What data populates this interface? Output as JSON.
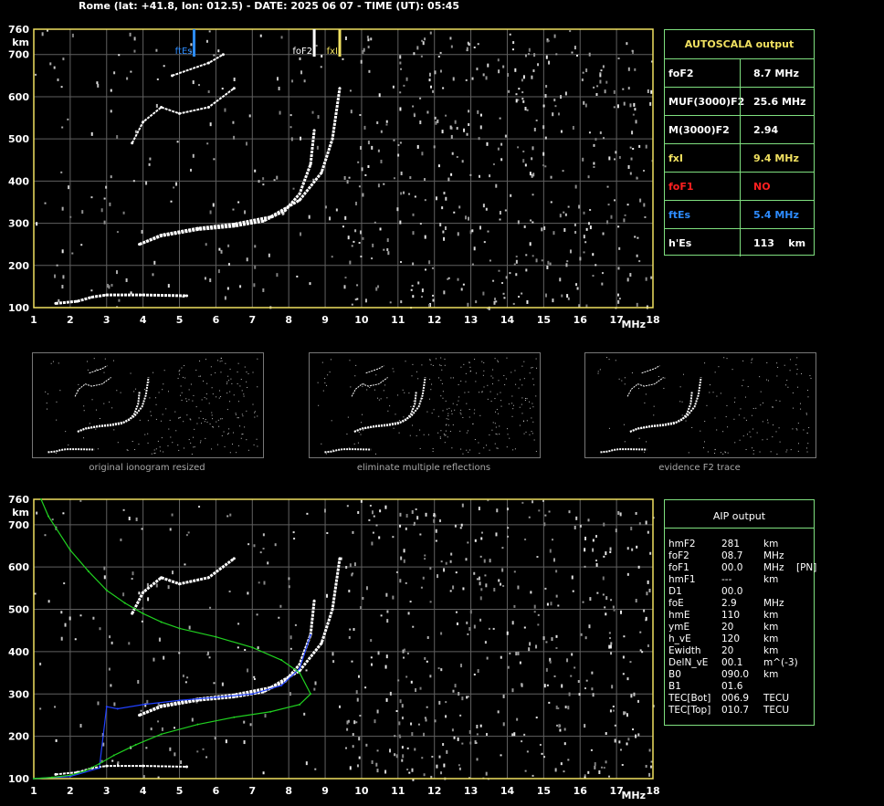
{
  "header": "Rome (lat: +41.8, lon: 012.5) - DATE: 2025 06 07 - TIME (UT): 05:45",
  "colors": {
    "axis": "#f0e060",
    "grid": "#606060",
    "trace": "#ffffff",
    "green": "#20d020",
    "blue": "#2040ff",
    "panel_border": "#7fe07f",
    "ftEs": "#2d8cff",
    "fxI": "#f0e060",
    "foF1": "#ff2020"
  },
  "chart_data": [
    {
      "type": "scatter",
      "title": "",
      "xlabel": "MHz",
      "ylabel": "km",
      "xlim": [
        1,
        18
      ],
      "ylim": [
        100,
        760
      ],
      "x_ticks": [
        "1",
        "2",
        "3",
        "4",
        "5",
        "6",
        "7",
        "8",
        "9",
        "10",
        "11",
        "12",
        "13",
        "14",
        "15",
        "16",
        "17",
        "18"
      ],
      "y_ticks": [
        "100",
        "200",
        "300",
        "400",
        "500",
        "600",
        "700",
        "760"
      ],
      "markers": [
        {
          "name": "ftEs",
          "x": 5.4,
          "color": "#2d8cff"
        },
        {
          "name": "foF2",
          "x": 8.7,
          "color": "#ffffff"
        },
        {
          "name": "fxI",
          "x": 9.4,
          "color": "#f0e060"
        }
      ],
      "series": [
        {
          "values": [
            [
              1.6,
              110
            ],
            [
              2.2,
              115
            ],
            [
              2.6,
              125
            ],
            [
              3.0,
              130
            ],
            [
              4.0,
              130
            ],
            [
              5.2,
              128
            ]
          ]
        },
        {
          "values": [
            [
              3.9,
              250
            ],
            [
              4.5,
              270
            ],
            [
              5.5,
              285
            ],
            [
              6.5,
              293
            ],
            [
              7.3,
              305
            ],
            [
              7.9,
              330
            ],
            [
              8.3,
              370
            ],
            [
              8.6,
              440
            ],
            [
              8.7,
              520
            ]
          ]
        },
        {
          "values": [
            [
              3.9,
              250
            ],
            [
              4.5,
              272
            ],
            [
              5.5,
              288
            ],
            [
              6.5,
              298
            ],
            [
              7.5,
              315
            ],
            [
              8.3,
              355
            ],
            [
              8.9,
              420
            ],
            [
              9.2,
              500
            ],
            [
              9.4,
              620
            ]
          ]
        },
        {
          "values": [
            [
              3.7,
              490
            ],
            [
              4.0,
              540
            ],
            [
              4.5,
              575
            ],
            [
              5.0,
              560
            ],
            [
              5.8,
              575
            ],
            [
              6.5,
              620
            ]
          ]
        },
        {
          "values": [
            [
              4.8,
              650
            ],
            [
              5.8,
              680
            ],
            [
              6.2,
              700
            ]
          ]
        }
      ]
    },
    {
      "type": "line",
      "title": "",
      "xlabel": "MHz",
      "ylabel": "km",
      "xlim": [
        1,
        18
      ],
      "ylim": [
        100,
        760
      ],
      "x_ticks": [
        "1",
        "2",
        "3",
        "4",
        "5",
        "6",
        "7",
        "8",
        "9",
        "10",
        "11",
        "12",
        "13",
        "14",
        "15",
        "16",
        "17",
        "18"
      ],
      "y_ticks": [
        "100",
        "200",
        "300",
        "400",
        "500",
        "600",
        "700",
        "760"
      ],
      "series": [
        {
          "values": [
            [
              3.9,
              250
            ],
            [
              4.5,
              270
            ],
            [
              5.5,
              285
            ],
            [
              6.5,
              293
            ],
            [
              7.3,
              305
            ],
            [
              7.9,
              330
            ],
            [
              8.3,
              370
            ],
            [
              8.6,
              440
            ],
            [
              8.7,
              520
            ]
          ]
        },
        {
          "values": [
            [
              3.9,
              250
            ],
            [
              4.5,
              272
            ],
            [
              5.5,
              288
            ],
            [
              6.5,
              298
            ],
            [
              7.5,
              315
            ],
            [
              8.3,
              355
            ],
            [
              8.9,
              420
            ],
            [
              9.2,
              500
            ],
            [
              9.4,
              620
            ]
          ]
        },
        {
          "values": [
            [
              3.7,
              490
            ],
            [
              4.0,
              540
            ],
            [
              4.5,
              575
            ],
            [
              5.0,
              560
            ],
            [
              5.8,
              575
            ],
            [
              6.5,
              620
            ]
          ]
        },
        {
          "values": [
            [
              1.6,
              110
            ],
            [
              2.2,
              115
            ],
            [
              2.6,
              125
            ],
            [
              3.0,
              130
            ],
            [
              4.0,
              130
            ],
            [
              5.2,
              128
            ]
          ]
        },
        {
          "color": "#2040ff",
          "values": [
            [
              1.0,
              100
            ],
            [
              2.0,
              105
            ],
            [
              2.8,
              125
            ],
            [
              3.0,
              270
            ],
            [
              3.3,
              265
            ],
            [
              4.0,
              275
            ],
            [
              5.0,
              285
            ],
            [
              6.0,
              292
            ],
            [
              7.0,
              300
            ],
            [
              7.8,
              320
            ],
            [
              8.3,
              360
            ],
            [
              8.6,
              440
            ]
          ]
        },
        {
          "color": "#20d020",
          "values": [
            [
              1.2,
              760
            ],
            [
              1.4,
              720
            ],
            [
              2.0,
              640
            ],
            [
              2.5,
              590
            ],
            [
              3.0,
              545
            ],
            [
              3.5,
              515
            ],
            [
              4.0,
              490
            ],
            [
              4.5,
              470
            ],
            [
              5.0,
              455
            ],
            [
              6.0,
              435
            ],
            [
              7.0,
              410
            ],
            [
              7.8,
              380
            ],
            [
              8.3,
              350
            ],
            [
              8.6,
              300
            ],
            [
              8.3,
              275
            ],
            [
              7.5,
              258
            ],
            [
              6.5,
              245
            ],
            [
              5.5,
              228
            ],
            [
              4.5,
              205
            ],
            [
              3.8,
              180
            ],
            [
              3.2,
              155
            ],
            [
              2.8,
              135
            ],
            [
              2.4,
              118
            ],
            [
              2.0,
              108
            ],
            [
              1.5,
              103
            ],
            [
              1.0,
              100
            ]
          ]
        }
      ]
    }
  ],
  "auto": {
    "title": "AUTOSCALA output",
    "rows": [
      {
        "k": "foF2",
        "v": "8.7 MHz",
        "kc": "#ffffff",
        "vc": "#ffffff"
      },
      {
        "k": "MUF(3000)F2",
        "v": "25.6 MHz",
        "kc": "#ffffff",
        "vc": "#ffffff"
      },
      {
        "k": "M(3000)F2",
        "v": "2.94",
        "kc": "#ffffff",
        "vc": "#ffffff"
      },
      {
        "k": "fxI",
        "v": "9.4 MHz",
        "kc": "#f0e060",
        "vc": "#f0e060"
      },
      {
        "k": "foF1",
        "v": "NO",
        "kc": "#ff2020",
        "vc": "#ff2020"
      },
      {
        "k": "ftEs",
        "v": "5.4 MHz",
        "kc": "#2d8cff",
        "vc": "#2d8cff"
      },
      {
        "k": "h'Es",
        "v": "113    km",
        "kc": "#ffffff",
        "vc": "#ffffff"
      }
    ]
  },
  "aip": {
    "title": "AIP output",
    "rows": [
      {
        "k": "hmF2",
        "v": "281",
        "u": "km",
        "e": ""
      },
      {
        "k": "foF2",
        "v": "08.7",
        "u": "MHz",
        "e": ""
      },
      {
        "k": "foF1",
        "v": "00.0",
        "u": "MHz",
        "e": "[PN]"
      },
      {
        "k": "hmF1",
        "v": "---",
        "u": "km",
        "e": ""
      },
      {
        "k": "D1",
        "v": "00.0",
        "u": "",
        "e": ""
      },
      {
        "k": "foE",
        "v": "2.9",
        "u": "MHz",
        "e": ""
      },
      {
        "k": "hmE",
        "v": "110",
        "u": "km",
        "e": ""
      },
      {
        "k": "ymE",
        "v": "20",
        "u": "km",
        "e": ""
      },
      {
        "k": "h_vE",
        "v": "120",
        "u": "km",
        "e": ""
      },
      {
        "k": "Ewidth",
        "v": "20",
        "u": "km",
        "e": ""
      },
      {
        "k": "DelN_vE",
        "v": "00.1",
        "u": "m^(-3)",
        "e": ""
      },
      {
        "k": "B0",
        "v": "090.0",
        "u": "km",
        "e": ""
      },
      {
        "k": "B1",
        "v": "01.6",
        "u": "",
        "e": ""
      },
      {
        "k": "TEC[Bot]",
        "v": "006.9",
        "u": "TECU",
        "e": ""
      },
      {
        "k": "TEC[Top]",
        "v": "010.7",
        "u": "TECU",
        "e": ""
      }
    ]
  },
  "thumbnails": [
    {
      "caption": "original ionogram resized"
    },
    {
      "caption": "eliminate multiple reflections"
    },
    {
      "caption": "evidence F2 trace"
    }
  ]
}
